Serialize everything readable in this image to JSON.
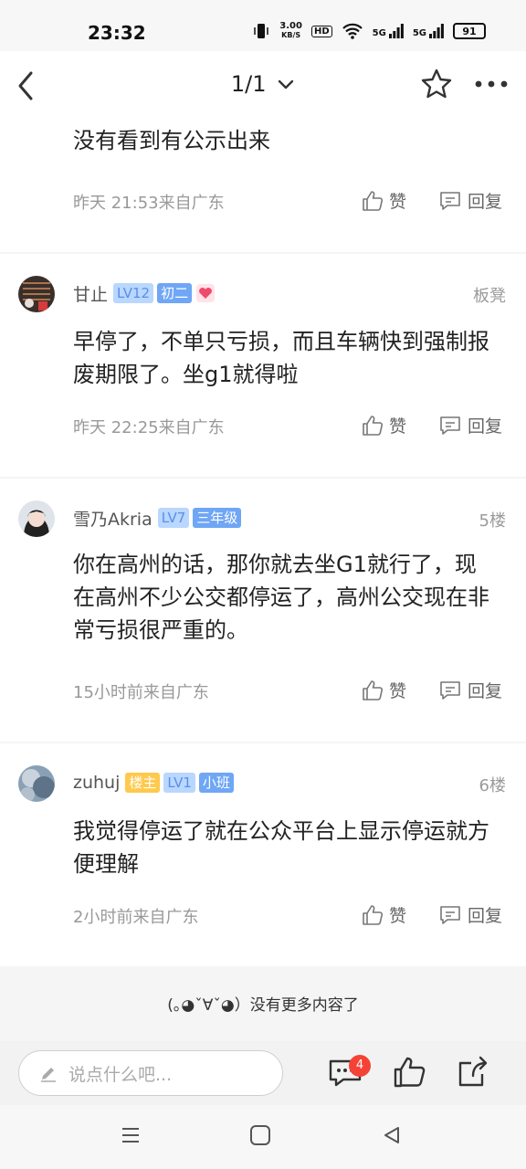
{
  "status_bar": {
    "time": "23:32",
    "speed_value": "3.00",
    "speed_unit": "KB/S",
    "hd": "HD",
    "network1": "5G",
    "network2": "5G",
    "battery": "91"
  },
  "header": {
    "page_indicator": "1/1"
  },
  "posts": [
    {
      "content": "没有看到有公示出来",
      "meta": "昨天 21:53来自广东",
      "like_label": "赞",
      "reply_label": "回复"
    },
    {
      "username": "甘止",
      "level": "LV12",
      "grade": "初二",
      "floor": "板凳",
      "content": "早停了，不单只亏损，而且车辆快到强制报废期限了。坐g1就得啦",
      "meta": "昨天 22:25来自广东",
      "like_label": "赞",
      "reply_label": "回复"
    },
    {
      "username": "雪乃Akria",
      "level": "LV7",
      "grade": "三年级",
      "floor": "5楼",
      "content": "你在高州的话，那你就去坐G1就行了，现在高州不少公交都停运了，高州公交现在非常亏损很严重的。",
      "meta": "15小时前来自广东",
      "like_label": "赞",
      "reply_label": "回复"
    },
    {
      "username": "zuhuj",
      "host_badge": "楼主",
      "level": "LV1",
      "grade": "小班",
      "floor": "6楼",
      "content": "我觉得停运了就在公众平台上显示停运就方便理解",
      "meta": "2小时前来自广东",
      "like_label": "赞",
      "reply_label": "回复"
    }
  ],
  "end_message": "(｡◕ˇ∀ˇ◕）没有更多内容了",
  "bottom_bar": {
    "input_placeholder": "说点什么吧...",
    "comment_count": "4"
  },
  "colors": {
    "accent_blue": "#6fa6f5",
    "badge_red": "#f44336",
    "host_yellow": "#ffc94d"
  }
}
